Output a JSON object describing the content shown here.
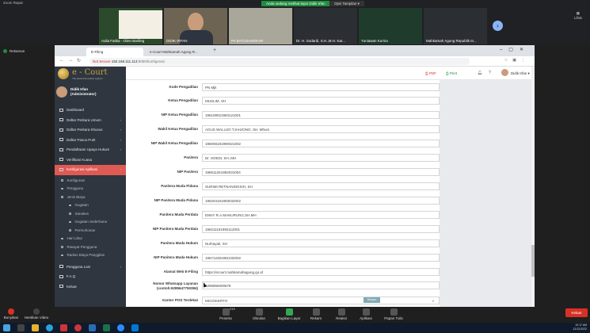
{
  "meet": {
    "window_title": "Zoom Rapat",
    "banner": "Anda sedang melihat layar Didik Irfan",
    "view_option": "Opsi Tampilan ▾",
    "participants": [
      {
        "name": "Aulia Fatika - Oiien Barilleg"
      },
      {
        "name": "DIDIK IRFAN"
      },
      {
        "name": "PA BATUSANGKAR"
      },
      {
        "name": "Dr. H. Sodardi, S.H.,M.H. Kar..."
      },
      {
        "name": "Yuniawan Kurnia"
      },
      {
        "name": "Mahkamah Agung Republik In..."
      }
    ],
    "view_button": "Lihat",
    "self_name": "Rekaman"
  },
  "browser": {
    "tabs": [
      {
        "label": "E-Filing"
      },
      {
        "label": "e-Court Mahkamah Agung R..."
      }
    ],
    "security": "Not Secure",
    "url_host": "192.168.111.113",
    "url_path": ":8080/konfigurasi",
    "new_tab": "+"
  },
  "app": {
    "brand": "e - Court",
    "tagline": "The electronic justice system",
    "user_name": "Didik Irfan",
    "user_role": "(Administrator)",
    "topbar": {
      "pdf": "PDF",
      "print": "Print",
      "user": "Didik Irfan ▾"
    },
    "menu": [
      {
        "label": "Dashboard",
        "chevron": ""
      },
      {
        "label": "Daftar Perkara Umum",
        "chevron": "‹"
      },
      {
        "label": "Daftar Perkara Khusus",
        "chevron": "‹"
      },
      {
        "label": "Daftar Pasca Putit",
        "chevron": "‹"
      },
      {
        "label": "Pendaftaran Upaya Hukum",
        "chevron": "‹"
      },
      {
        "label": "Verifikasi Kuasa",
        "chevron": ""
      },
      {
        "label": "Konfigurasi Aplikasi",
        "chevron": "‹"
      }
    ],
    "submenu": [
      {
        "label": "Konfigurasi",
        "level": 1
      },
      {
        "label": "Pengguna",
        "level": 1
      },
      {
        "label": "Jenis Biaya",
        "level": 1
      },
      {
        "label": "Gugatan",
        "level": 2
      },
      {
        "label": "Sanakes",
        "level": 2
      },
      {
        "label": "Gugatan Sederhana",
        "level": 2
      },
      {
        "label": "Permohonan",
        "level": 2
      },
      {
        "label": "Hari Libur",
        "level": 1
      },
      {
        "label": "Riwayat Pengguna",
        "level": 1
      },
      {
        "label": "Radius Biaya Panggilan",
        "level": 1
      }
    ],
    "menu_bottom": [
      {
        "label": "Pengguna Lain",
        "chevron": "‹"
      },
      {
        "label": "F.A.Q",
        "chevron": ""
      },
      {
        "label": "Keluar",
        "chevron": ""
      }
    ],
    "form": [
      {
        "label": "Kode Pengadilan",
        "value": "PN Mjk"
      },
      {
        "label": "Ketua Pengadilan",
        "value": "MUSLIM, SH"
      },
      {
        "label": "NIP Ketua Pengadilan",
        "value": "196109021983121001"
      },
      {
        "label": "Wakil Ketua Pengadilan",
        "value": "AGUS WALUJO TJAHJONO, SH. Mhum"
      },
      {
        "label": "NIP Wakil Ketua Pengadilan",
        "value": "196008181990021002"
      },
      {
        "label": "Panitera",
        "value": "Dr. SOEDI, SH.,MH"
      },
      {
        "label": "NIP Panitera",
        "value": "196611261992031004"
      },
      {
        "label": "Panitera Muda Pidana",
        "value": "SURIMI RETNANINGSIH, SH"
      },
      {
        "label": "NIP Panitera Muda Pidana",
        "value": "196204161993032002"
      },
      {
        "label": "Panitera Muda Perdata",
        "value": "ENNY R.A.MANURUNG,SH.MH"
      },
      {
        "label": "NIP Panitera Muda Perdata",
        "value": "196211191992112001"
      },
      {
        "label": "Panitera Muda Hukum",
        "value": "Nurhayati, SH"
      },
      {
        "label": "NIP Panitera Muda Hukum",
        "value": "196712281991032002"
      },
      {
        "label": "Alamat Web E-Filing",
        "value": "https://ecourt.mahkamahagung.go.id"
      },
      {
        "label": "Nomor Whatsapp Layanan (contoh:6285647750384)",
        "value": "6285856000678"
      },
      {
        "label": "Kantor POS Terdekat",
        "value": "MOJOKERTO"
      }
    ],
    "save_button": "Simpan"
  },
  "toolbar": {
    "left": [
      {
        "label": "Bunyikan"
      },
      {
        "label": "Hentikan Video"
      }
    ],
    "center": [
      {
        "label": "Peserta",
        "badge": "219"
      },
      {
        "label": "Obrolan"
      },
      {
        "label": "Bagikan Layar"
      },
      {
        "label": "Rekam"
      },
      {
        "label": "Reaksi"
      },
      {
        "label": "Aplikasi"
      },
      {
        "label": "Papan Tulis"
      }
    ],
    "end_button": "Keluar"
  },
  "taskbar": {
    "time": "10:17 AM",
    "date": "12/12/2022"
  }
}
